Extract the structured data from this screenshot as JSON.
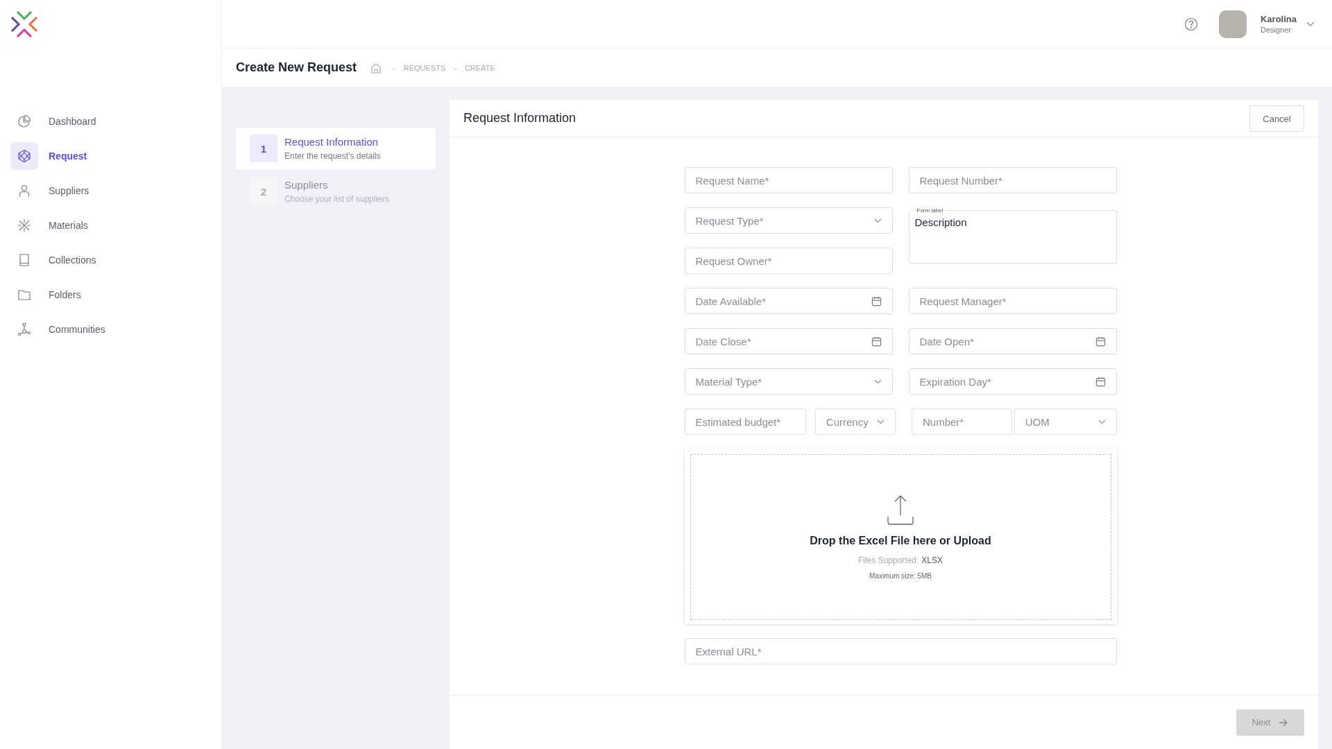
{
  "sidebar": {
    "items": [
      {
        "label": "Dashboard",
        "selected": false
      },
      {
        "label": "Request",
        "selected": true
      },
      {
        "label": "Suppliers",
        "selected": false
      },
      {
        "label": "Materials",
        "selected": false
      },
      {
        "label": "Collections",
        "selected": false
      },
      {
        "label": "Folders",
        "selected": false
      },
      {
        "label": "Communities",
        "selected": false
      }
    ]
  },
  "topbar": {
    "user": {
      "name": "Karolina",
      "role": "Designer"
    }
  },
  "header": {
    "title": "Create New Request",
    "breadcrumb": [
      {
        "separator": "-",
        "label": "REQUESTS"
      },
      {
        "separator": "-",
        "label": "CREATE"
      }
    ]
  },
  "steps": [
    {
      "number": "1",
      "title": "Request Information",
      "subtitle": "Enter the request’s details",
      "selected": true
    },
    {
      "number": "2",
      "title": "Suppliers",
      "subtitle": "Choose your list of suppliers",
      "selected": false
    }
  ],
  "card": {
    "title": "Request Information",
    "cancel": "Cancel",
    "form": {
      "left": [
        {
          "kind": "text",
          "placeholder": "Request Name*"
        },
        {
          "kind": "select",
          "placeholder": "Request Type*"
        },
        {
          "kind": "text",
          "placeholder": "Request Owner*"
        },
        {
          "kind": "date",
          "placeholder": "Date Available*"
        },
        {
          "kind": "date",
          "placeholder": "Date Close*"
        },
        {
          "kind": "select",
          "placeholder": "Material Type*"
        }
      ],
      "right": [
        {
          "kind": "text",
          "placeholder": "Request Number*"
        },
        {
          "kind": "textarea",
          "label": "Form label",
          "value": "Description"
        },
        {
          "kind": "text",
          "placeholder": "Request Manager*"
        },
        {
          "kind": "date",
          "placeholder": "Date Open*"
        },
        {
          "kind": "date",
          "placeholder": "Expiration Day*"
        }
      ],
      "bottom_row": [
        {
          "kind": "text",
          "placeholder": "Estimated budget*"
        },
        {
          "kind": "select",
          "placeholder": "Currency"
        },
        {
          "kind": "text",
          "placeholder": "Number*"
        },
        {
          "kind": "select",
          "placeholder": "UOM"
        }
      ],
      "upload": {
        "title": "Drop the Excel File here or Upload",
        "supported_label": "Files Supported:",
        "supported_value": "XLSX",
        "max_size": "Maximum size: 5MB"
      },
      "external_url": {
        "kind": "text",
        "placeholder": "External URL*"
      }
    },
    "next": {
      "label": "Next",
      "disabled": true
    }
  }
}
